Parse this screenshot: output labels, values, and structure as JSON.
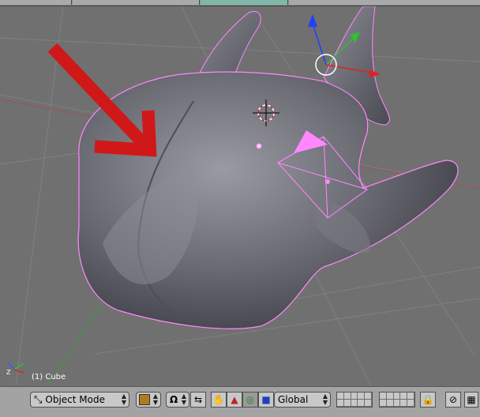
{
  "viewport": {
    "object_info": "(1) Cube"
  },
  "header": {
    "mode_label": "Object Mode",
    "orientation_label": "Global"
  },
  "colors": {
    "viewport_bg": "#707070",
    "mesh": "#5a5a62",
    "selection_outline": "#ff88ff",
    "annotation_arrow": "#d01818",
    "header_bg": "#a3a3a3"
  },
  "icons": [
    "mode-icon",
    "shading-icon",
    "pivot-icon",
    "snap-icon",
    "hand-icon",
    "triangle-icon",
    "circle-icon",
    "square-icon",
    "lock-icon",
    "magnet-icon",
    "render-icon"
  ]
}
